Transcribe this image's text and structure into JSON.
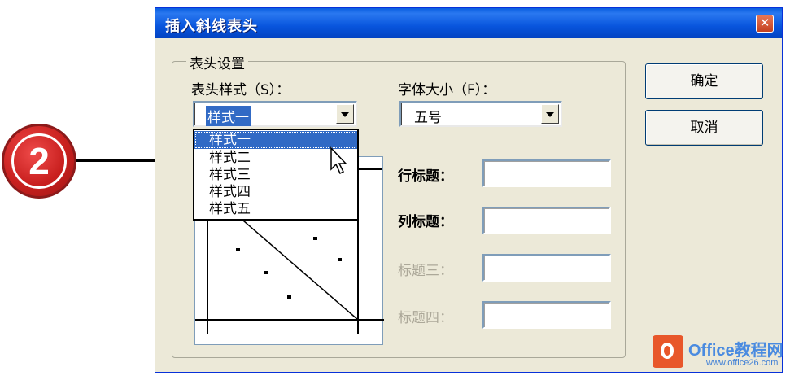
{
  "callout": {
    "number": "2"
  },
  "dialog": {
    "title": "插入斜线表头",
    "close_icon": "close-icon",
    "group_label": "表头设置",
    "header_style": {
      "label": "表头样式（S）：",
      "value": "样式一",
      "options": [
        "样式一",
        "样式二",
        "样式三",
        "样式四",
        "样式五"
      ],
      "highlighted": "样式一"
    },
    "font_size": {
      "label": "字体大小（F）：",
      "value": "五号"
    },
    "fields": {
      "row_title": "行标题：",
      "col_title": "列标题：",
      "title3": "标题三：",
      "title4": "标题四："
    },
    "buttons": {
      "ok": "确定",
      "cancel": "取消"
    }
  },
  "watermark": {
    "brand": "Office教程网",
    "url": "www.office26.com"
  },
  "colors": {
    "titlebar": "#0a5ee0",
    "selection": "#316ac5",
    "dialog_bg": "#ece9d8",
    "callout": "#c9211f"
  }
}
